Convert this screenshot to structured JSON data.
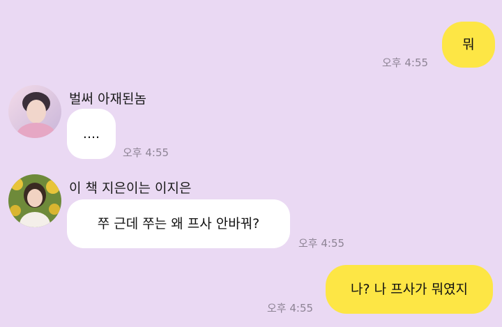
{
  "messages": [
    {
      "side": "me",
      "text": "뭐",
      "time": "오후 4:55"
    },
    {
      "side": "other",
      "sender": "벌써 아재된놈",
      "avatar": "person-avatar-pink",
      "text": "....",
      "time": "오후 4:55"
    },
    {
      "side": "other",
      "sender": "이 책 지은이는 이지은",
      "avatar": "person-avatar-sunflower",
      "text": "쭈 근데 쭈는 왜 프사 안바꿔?",
      "time": "오후 4:55"
    },
    {
      "side": "me",
      "text": "나? 나 프사가 뭐였지",
      "time": "오후 4:55"
    }
  ],
  "colors": {
    "background": "#ead9f3",
    "my_bubble": "#fde645",
    "other_bubble": "#ffffff",
    "timestamp": "#8d8394"
  }
}
